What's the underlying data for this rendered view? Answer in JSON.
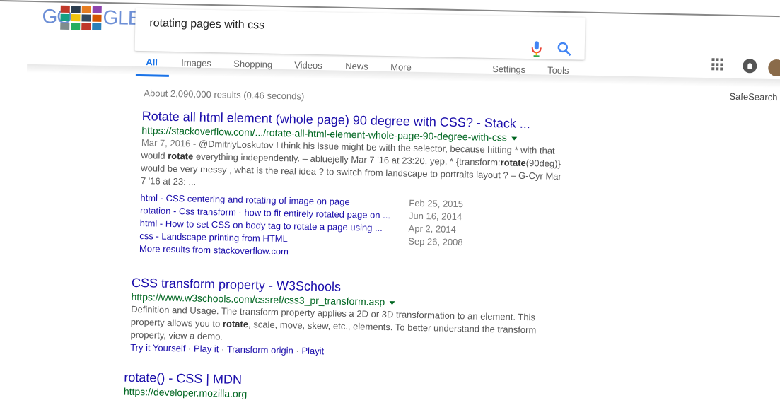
{
  "logo": {
    "left_letters": "GO",
    "right_letters": "GLE"
  },
  "search": {
    "query": "rotating pages with css"
  },
  "tabs": [
    "All",
    "Images",
    "Shopping",
    "Videos",
    "News",
    "More"
  ],
  "tools": {
    "settings": "Settings",
    "tools": "Tools"
  },
  "safesearch": "SafeSearch",
  "stats": "About 2,090,000 results (0.46 seconds)",
  "results": [
    {
      "title": "Rotate all html element (whole page) 90 degree with CSS? - Stack ...",
      "url": "https://stackoverflow.com/.../rotate-all-html-element-whole-page-90-degree-with-css",
      "date": "Mar 7, 2016",
      "snippet_line1_start": " - @DmitriyLoskutov I think his issue might be with the selector, because hitting * with that",
      "snippet_line2_pre": "would ",
      "snippet_line2_bold": "rotate",
      "snippet_line2_post": " everything independently. – abluejelly Mar 7 '16 at 23:20. yep, * {transform:",
      "snippet_line2_bold2": "rotate",
      "snippet_line2_post2": "(90deg)}",
      "snippet_line3": "would be very messy , what is the real idea ? to switch from landscape to portraits layout ? – G-Cyr Mar",
      "snippet_line4": "7 '16 at 23: ...",
      "sitelinks": [
        {
          "text": "html - CSS centering and rotating of image on page",
          "date": "Feb 25, 2015"
        },
        {
          "text": "rotation - Css transform - how to fit entirely rotated page on ...",
          "date": "Jun 16, 2014"
        },
        {
          "text": "html - How to set CSS on body tag to rotate a page using ...",
          "date": "Apr 2, 2014"
        },
        {
          "text": "css - Landscape printing from HTML",
          "date": "Sep 26, 2008"
        }
      ],
      "more": "More results from stackoverflow.com"
    },
    {
      "title": "CSS transform property - W3Schools",
      "url": "https://www.w3schools.com/cssref/css3_pr_transform.asp",
      "snippet_line1": "Definition and Usage. The transform property applies a 2D or 3D transformation to an element. This",
      "snippet_line2_pre": "property allows you to ",
      "snippet_line2_bold": "rotate",
      "snippet_line2_post": ", scale, move, skew, etc., elements. To better understand the transform",
      "snippet_line3": "property, view a demo.",
      "deeplinks": [
        "Try it Yourself",
        "Play it",
        "Transform origin",
        "Playit"
      ]
    },
    {
      "title": "rotate() - CSS | MDN",
      "url": "https://developer.mozilla.org"
    }
  ],
  "colors": {
    "link": "#1a0dab",
    "url": "#006621",
    "accent": "#1a73e8"
  },
  "icons": [
    "mic-icon",
    "search-icon",
    "apps-grid-icon",
    "notifications-icon",
    "avatar"
  ]
}
